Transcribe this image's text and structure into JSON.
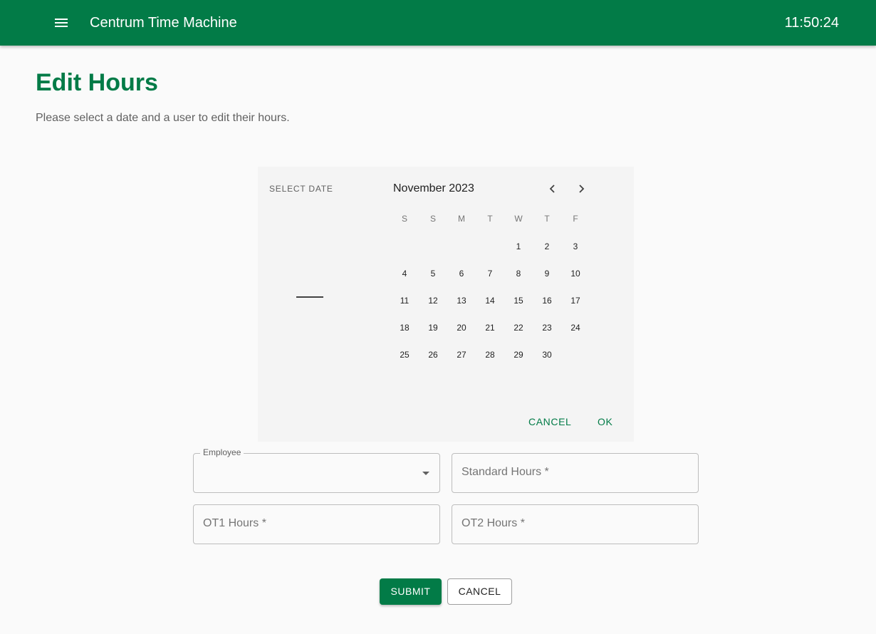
{
  "appbar": {
    "menu_icon": "menu-icon",
    "title": "Centrum Time Machine",
    "clock": "11:50:24",
    "color": "#027b47"
  },
  "page": {
    "title": "Edit Hours",
    "subtitle": "Please select a date and a user to edit their hours."
  },
  "date_picker": {
    "toolbar_label": "SELECT DATE",
    "month_label": "November 2023",
    "prev_icon": "chevron-left-icon",
    "next_icon": "chevron-right-icon",
    "weekdays": [
      "S",
      "S",
      "M",
      "T",
      "W",
      "T",
      "F"
    ],
    "days": [
      "1",
      "2",
      "3",
      "4",
      "5",
      "6",
      "7",
      "8",
      "9",
      "10",
      "11",
      "12",
      "13",
      "14",
      "15",
      "16",
      "17",
      "18",
      "19",
      "20",
      "21",
      "22",
      "23",
      "24",
      "25",
      "26",
      "27",
      "28",
      "29",
      "30"
    ],
    "first_day_column": 4,
    "cancel_label": "CANCEL",
    "ok_label": "OK"
  },
  "form": {
    "employee": {
      "label": "Employee",
      "value": ""
    },
    "standard_hours": {
      "placeholder": "Standard Hours *"
    },
    "ot1_hours": {
      "placeholder": "OT1 Hours *"
    },
    "ot2_hours": {
      "placeholder": "OT2 Hours *"
    },
    "submit_label": "SUBMIT",
    "cancel_label": "CANCEL"
  }
}
